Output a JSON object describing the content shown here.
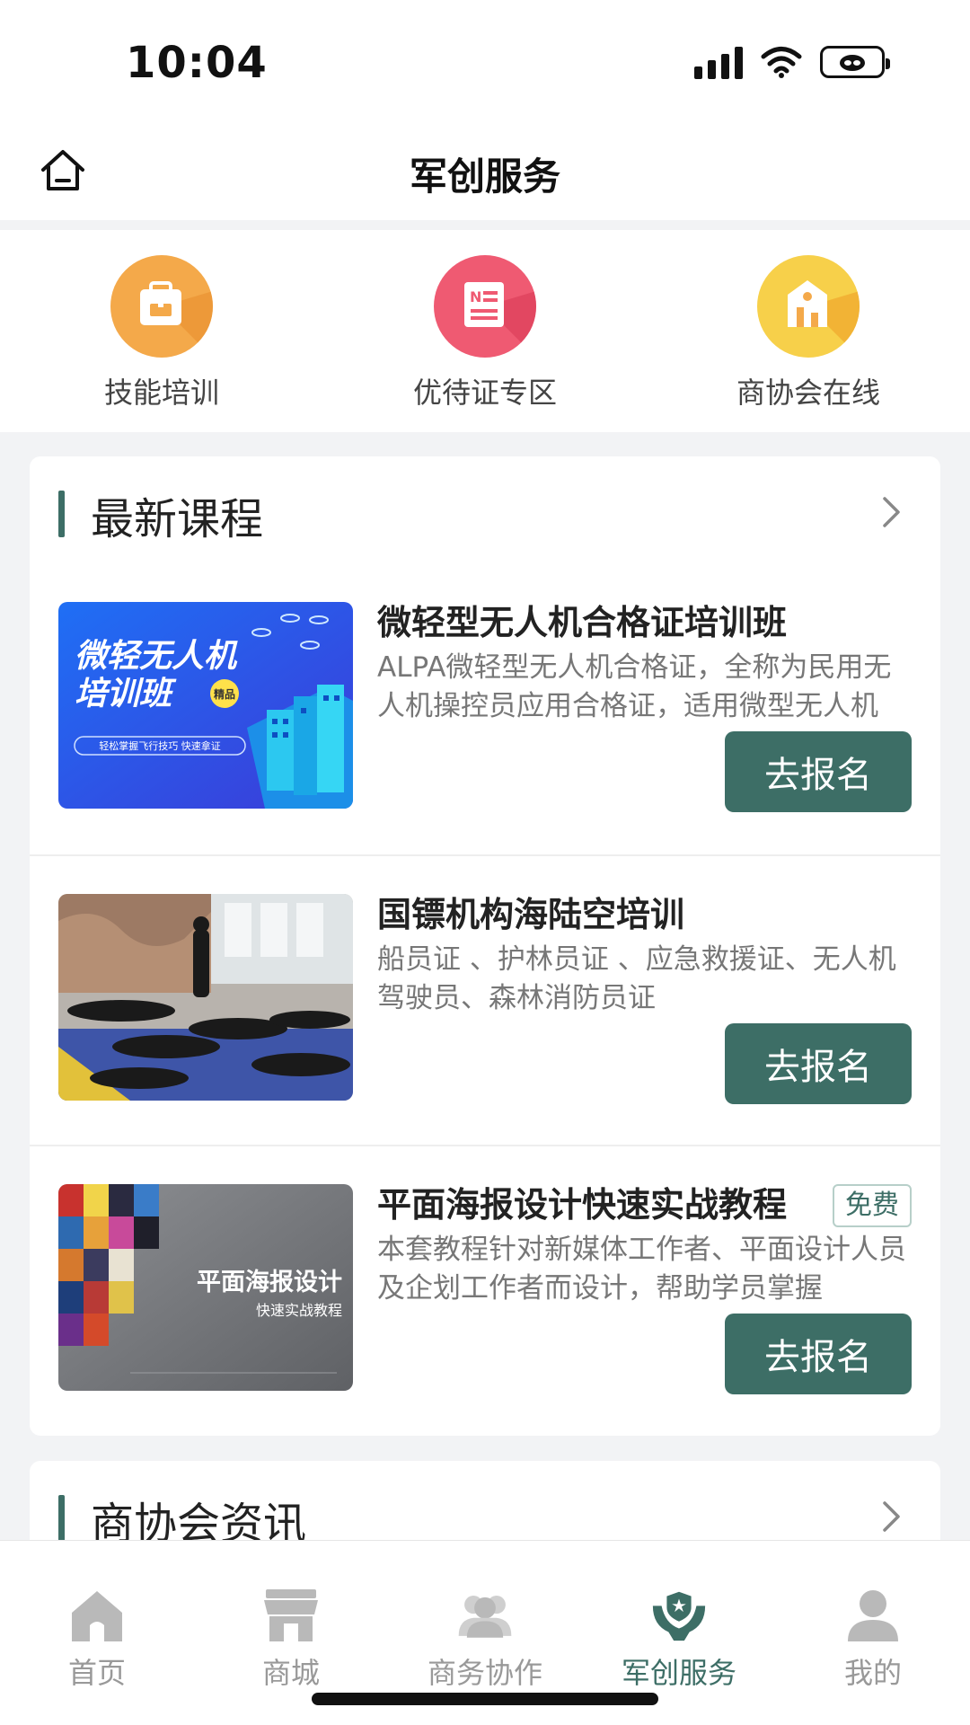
{
  "status": {
    "time": "10:04"
  },
  "nav": {
    "title": "军创服务"
  },
  "quick_entries": [
    {
      "label": "技能培训",
      "icon": "briefcase-icon"
    },
    {
      "label": "优待证专区",
      "icon": "certificate-icon"
    },
    {
      "label": "商协会在线",
      "icon": "building-icon"
    }
  ],
  "courses_section": {
    "title": "最新课程",
    "items": [
      {
        "title": "微轻型无人机合格证培训班",
        "desc": "ALPA微轻型无人机合格证，全称为民用无人机操控员应用合格证，适用微型无人机",
        "button": "去报名",
        "thumb": {
          "line1": "微轻无人机",
          "line2": "培训班",
          "tag": "精品",
          "sub": "轻松掌握飞行技巧 快速拿证"
        }
      },
      {
        "title": "国镖机构海陆空培训",
        "desc": "船员证 、护林员证 、应急救援证、无人机驾驶员、森林消防员证",
        "button": "去报名"
      },
      {
        "title": "平面海报设计快速实战教程",
        "badge": "免费",
        "desc": "本套教程针对新媒体工作者、平面设计人员及企划工作者而设计，帮助学员掌握",
        "button": "去报名",
        "thumb": {
          "line1": "平面海报设计",
          "line2": "快速实战教程"
        }
      }
    ]
  },
  "news_section": {
    "title": "商协会资讯"
  },
  "tabbar": {
    "items": [
      {
        "label": "首页",
        "icon": "home-icon"
      },
      {
        "label": "商城",
        "icon": "store-icon"
      },
      {
        "label": "商务协作",
        "icon": "users-icon"
      },
      {
        "label": "军创服务",
        "icon": "hands-shield-icon",
        "active": true
      },
      {
        "label": "我的",
        "icon": "person-icon"
      }
    ]
  },
  "colors": {
    "accent": "#3d6e66",
    "orange": "#f4a94a",
    "red": "#ef5a72",
    "yellow": "#f7d04a"
  }
}
